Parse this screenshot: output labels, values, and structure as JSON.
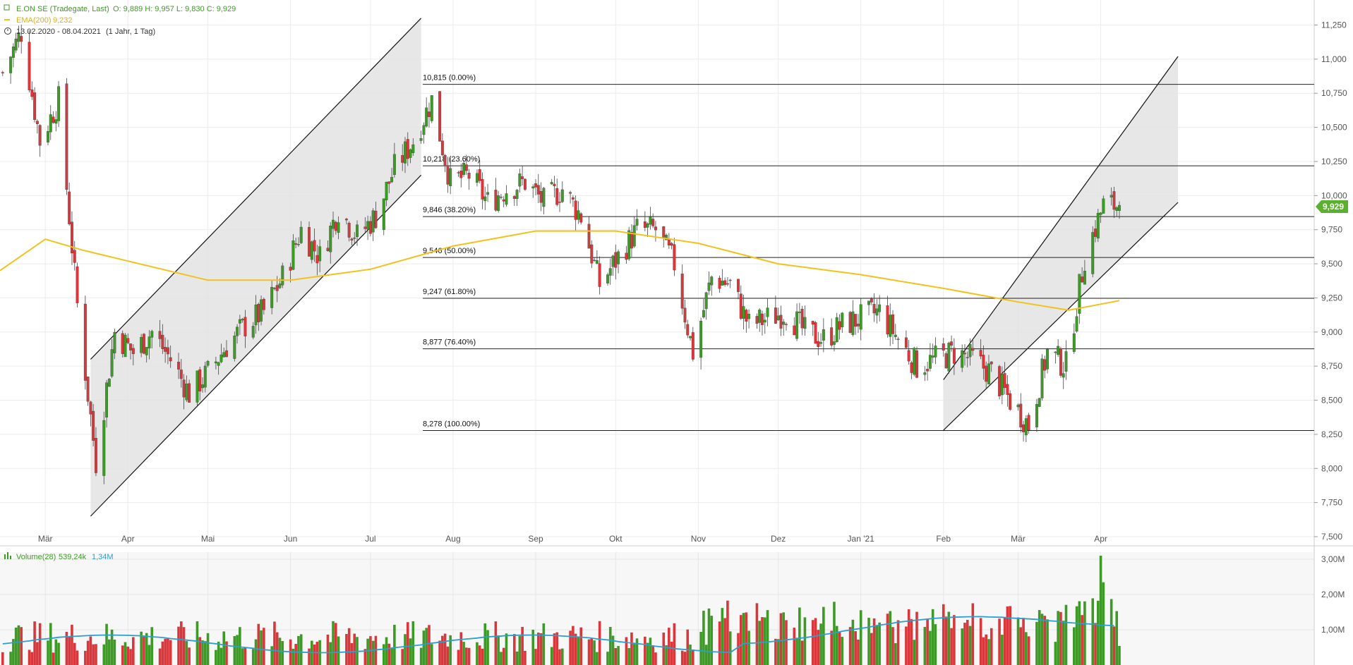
{
  "header": {
    "title": "E.ON SE (Tradegate, Last)",
    "ohlc": "O: 9,889  H: 9,957  L: 9,830  C: 9,929",
    "ema_label": "EMA(200)",
    "ema_value": "9,232",
    "range": "13.02.2020 - 08.04.2021",
    "period": "(1 Jahr, 1 Tag)",
    "volume_label": "Volume(28)",
    "volume_value": "539,24k",
    "volume_avg": "1,34M",
    "last_price_badge": "9,929"
  },
  "colors": {
    "up": "#3e9a26",
    "down": "#d8383b",
    "ema": "#f2c21b",
    "volume_avg": "#2a9fd0",
    "badge": "#5cb030",
    "channel_fill": "#e3e3e3"
  },
  "chart_data": [
    {
      "type": "candlestick",
      "title": "E.ON SE (Tradegate, Last)",
      "x_tick_labels": [
        "Mär",
        "Apr",
        "Mai",
        "Jun",
        "Jul",
        "Aug",
        "Sep",
        "Okt",
        "Nov",
        "Dez",
        "Jan '21",
        "Feb",
        "Mär",
        "Apr"
      ],
      "y_tick_labels": [
        "7,500",
        "7,750",
        "8,000",
        "8,250",
        "8,500",
        "8,750",
        "9,000",
        "9,250",
        "9,500",
        "9,750",
        "10,000",
        "10,250",
        "10,500",
        "10,750",
        "11,000",
        "11,250"
      ],
      "ylim": [
        7.5,
        11.35
      ],
      "fibonacci_levels": [
        {
          "label": "10,815 (0.00%)",
          "value": 10.815
        },
        {
          "label": "10,218 (23.60%)",
          "value": 10.218
        },
        {
          "label": "9,846 (38.20%)",
          "value": 9.846
        },
        {
          "label": "9,546 (50.00%)",
          "value": 9.546
        },
        {
          "label": "9,247 (61.80%)",
          "value": 9.247
        },
        {
          "label": "8,877 (76.40%)",
          "value": 8.877
        },
        {
          "label": "8,278 (100.00%)",
          "value": 8.278
        }
      ],
      "channels": [
        {
          "start_date": "2020-03-18",
          "end_date": "2020-07-20",
          "upper": [
            8.8,
            11.3
          ],
          "lower": [
            7.65,
            10.15
          ]
        },
        {
          "start_date": "2021-02-01",
          "end_date": "2021-04-30",
          "upper": [
            8.65,
            11.02
          ],
          "lower": [
            8.28,
            9.95
          ]
        }
      ],
      "ema200": [
        [
          "2020-02-13",
          9.45
        ],
        [
          "2020-03-01",
          9.68
        ],
        [
          "2020-03-15",
          9.6
        ],
        [
          "2020-04-01",
          9.52
        ],
        [
          "2020-05-01",
          9.38
        ],
        [
          "2020-06-01",
          9.38
        ],
        [
          "2020-07-01",
          9.46
        ],
        [
          "2020-08-01",
          9.63
        ],
        [
          "2020-09-01",
          9.74
        ],
        [
          "2020-10-01",
          9.74
        ],
        [
          "2020-11-01",
          9.65
        ],
        [
          "2020-12-01",
          9.5
        ],
        [
          "2021-01-01",
          9.42
        ],
        [
          "2021-02-01",
          9.32
        ],
        [
          "2021-03-01",
          9.22
        ],
        [
          "2021-03-20",
          9.16
        ],
        [
          "2021-04-08",
          9.23
        ]
      ],
      "series": [
        {
          "name": "E.ON SE",
          "weekly_closes": [
            [
              "2020-02-14",
              10.9
            ],
            [
              "2020-02-21",
              11.2
            ],
            [
              "2020-02-28",
              10.4
            ],
            [
              "2020-03-06",
              10.7
            ],
            [
              "2020-03-13",
              9.2
            ],
            [
              "2020-03-20",
              8.05
            ],
            [
              "2020-03-27",
              9.0
            ],
            [
              "2020-04-03",
              8.85
            ],
            [
              "2020-04-10",
              9.0
            ],
            [
              "2020-04-17",
              8.8
            ],
            [
              "2020-04-24",
              8.55
            ],
            [
              "2020-05-01",
              8.7
            ],
            [
              "2020-05-08",
              8.9
            ],
            [
              "2020-05-15",
              9.05
            ],
            [
              "2020-05-22",
              9.15
            ],
            [
              "2020-05-29",
              9.4
            ],
            [
              "2020-06-05",
              9.75
            ],
            [
              "2020-06-12",
              9.55
            ],
            [
              "2020-06-19",
              9.9
            ],
            [
              "2020-06-26",
              9.7
            ],
            [
              "2020-07-03",
              9.85
            ],
            [
              "2020-07-10",
              10.2
            ],
            [
              "2020-07-17",
              10.4
            ],
            [
              "2020-07-24",
              10.7
            ],
            [
              "2020-07-31",
              10.1
            ],
            [
              "2020-08-07",
              10.15
            ],
            [
              "2020-08-14",
              9.95
            ],
            [
              "2020-08-21",
              10.05
            ],
            [
              "2020-08-28",
              10.1
            ],
            [
              "2020-09-04",
              9.95
            ],
            [
              "2020-09-11",
              10.05
            ],
            [
              "2020-09-18",
              9.85
            ],
            [
              "2020-09-25",
              9.35
            ],
            [
              "2020-10-02",
              9.55
            ],
            [
              "2020-10-09",
              9.75
            ],
            [
              "2020-10-16",
              9.75
            ],
            [
              "2020-10-23",
              9.5
            ],
            [
              "2020-10-30",
              8.85
            ],
            [
              "2020-11-06",
              9.4
            ],
            [
              "2020-11-13",
              9.35
            ],
            [
              "2020-11-20",
              9.05
            ],
            [
              "2020-11-27",
              9.1
            ],
            [
              "2020-12-04",
              9.15
            ],
            [
              "2020-12-11",
              9.0
            ],
            [
              "2020-12-18",
              8.95
            ],
            [
              "2020-12-25",
              9.05
            ],
            [
              "2021-01-01",
              9.1
            ],
            [
              "2021-01-08",
              9.15
            ],
            [
              "2021-01-15",
              8.95
            ],
            [
              "2021-01-22",
              8.75
            ],
            [
              "2021-01-29",
              8.8
            ],
            [
              "2021-02-05",
              8.85
            ],
            [
              "2021-02-12",
              8.8
            ],
            [
              "2021-02-19",
              8.7
            ],
            [
              "2021-02-26",
              8.5
            ],
            [
              "2021-03-05",
              8.32
            ],
            [
              "2021-03-12",
              8.85
            ],
            [
              "2021-03-19",
              8.75
            ],
            [
              "2021-03-26",
              9.55
            ],
            [
              "2021-04-02",
              9.93
            ],
            [
              "2021-04-08",
              9.929
            ]
          ]
        }
      ]
    },
    {
      "type": "bar",
      "title": "Volume(28)",
      "y_tick_labels": [
        "1,00M",
        "2,00M",
        "3,00M"
      ],
      "ylim": [
        0,
        3.2
      ],
      "notes": "daily volume in millions, coloured by candle direction; line = 28-day average"
    }
  ]
}
